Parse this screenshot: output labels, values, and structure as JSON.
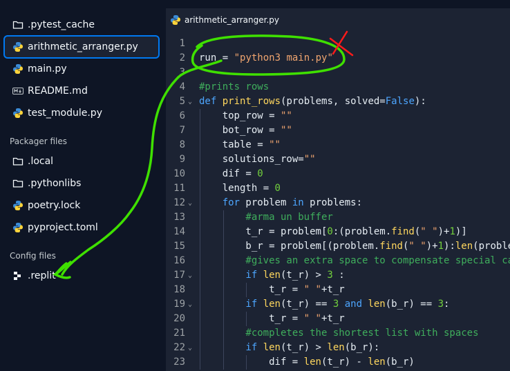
{
  "sidebar": {
    "files": [
      {
        "name": "pytest-cache-folder",
        "label": ".pytest_cache",
        "icon": "folder-icon"
      },
      {
        "name": "file-arithmetic-arranger",
        "label": "arithmetic_arranger.py",
        "icon": "python-icon"
      },
      {
        "name": "file-main",
        "label": "main.py",
        "icon": "python-icon"
      },
      {
        "name": "file-readme",
        "label": "README.md",
        "icon": "markdown-icon"
      },
      {
        "name": "file-test-module",
        "label": "test_module.py",
        "icon": "python-icon"
      }
    ],
    "packager_header": "Packager files",
    "packager_files": [
      {
        "label": ".local",
        "icon": "folder-icon"
      },
      {
        "label": ".pythonlibs",
        "icon": "folder-icon"
      },
      {
        "label": "poetry.lock",
        "icon": "python-icon"
      },
      {
        "label": "pyproject.toml",
        "icon": "python-icon"
      }
    ],
    "config_header": "Config files",
    "config_files": [
      {
        "label": ".replit",
        "icon": "replit-icon"
      }
    ]
  },
  "editor": {
    "tab_label": "arithmetic_arranger.py",
    "lines": [
      {
        "n": "1",
        "fold": false,
        "indent": 0,
        "tokens": []
      },
      {
        "n": "2",
        "fold": false,
        "indent": 0,
        "tokens": [
          [
            "var",
            "run"
          ],
          [
            "var",
            " = "
          ],
          [
            "str",
            "\"python3 main.py\""
          ]
        ]
      },
      {
        "n": "3",
        "fold": false,
        "indent": 0,
        "tokens": []
      },
      {
        "n": "4",
        "fold": false,
        "indent": 0,
        "tokens": [
          [
            "cmt",
            "#prints rows"
          ]
        ]
      },
      {
        "n": "5",
        "fold": true,
        "indent": 0,
        "tokens": [
          [
            "kw",
            "def "
          ],
          [
            "fn",
            "print_rows"
          ],
          [
            "var",
            "(problems, solved="
          ],
          [
            "bool",
            "False"
          ],
          [
            "var",
            "):"
          ]
        ]
      },
      {
        "n": "6",
        "fold": false,
        "indent": 1,
        "tokens": [
          [
            "var",
            "top_row = "
          ],
          [
            "str",
            "\"\""
          ]
        ]
      },
      {
        "n": "7",
        "fold": false,
        "indent": 1,
        "tokens": [
          [
            "var",
            "bot_row = "
          ],
          [
            "str",
            "\"\""
          ]
        ]
      },
      {
        "n": "8",
        "fold": false,
        "indent": 1,
        "tokens": [
          [
            "var",
            "table = "
          ],
          [
            "str",
            "\"\""
          ]
        ]
      },
      {
        "n": "9",
        "fold": false,
        "indent": 1,
        "tokens": [
          [
            "var",
            "solutions_row="
          ],
          [
            "str",
            "\"\""
          ]
        ]
      },
      {
        "n": "10",
        "fold": false,
        "indent": 1,
        "tokens": [
          [
            "var",
            "dif = "
          ],
          [
            "num",
            "0"
          ]
        ]
      },
      {
        "n": "11",
        "fold": false,
        "indent": 1,
        "tokens": [
          [
            "var",
            "length = "
          ],
          [
            "num",
            "0"
          ]
        ]
      },
      {
        "n": "12",
        "fold": true,
        "indent": 1,
        "tokens": [
          [
            "kw",
            "for "
          ],
          [
            "var",
            "problem "
          ],
          [
            "kw",
            "in "
          ],
          [
            "var",
            "problems:"
          ]
        ]
      },
      {
        "n": "13",
        "fold": false,
        "indent": 2,
        "tokens": [
          [
            "cmt",
            "#arma un buffer"
          ]
        ]
      },
      {
        "n": "14",
        "fold": false,
        "indent": 2,
        "tokens": [
          [
            "var",
            "t_r = problem["
          ],
          [
            "num",
            "0"
          ],
          [
            "var",
            ":(problem."
          ],
          [
            "fn",
            "find"
          ],
          [
            "var",
            "("
          ],
          [
            "str",
            "\" \""
          ],
          [
            "var",
            ")+"
          ],
          [
            "num",
            "1"
          ],
          [
            "var",
            ")]"
          ]
        ]
      },
      {
        "n": "15",
        "fold": false,
        "indent": 2,
        "tokens": [
          [
            "var",
            "b_r = problem[(problem."
          ],
          [
            "fn",
            "find"
          ],
          [
            "var",
            "("
          ],
          [
            "str",
            "\" \""
          ],
          [
            "var",
            ")+"
          ],
          [
            "num",
            "1"
          ],
          [
            "var",
            "):"
          ],
          [
            "fn",
            "len"
          ],
          [
            "var",
            "(problem)]"
          ]
        ]
      },
      {
        "n": "16",
        "fold": false,
        "indent": 2,
        "tokens": [
          [
            "cmt",
            "#gives an extra space to compensate special cases"
          ]
        ]
      },
      {
        "n": "17",
        "fold": true,
        "indent": 2,
        "tokens": [
          [
            "kw",
            "if "
          ],
          [
            "fn",
            "len"
          ],
          [
            "var",
            "(t_r) > "
          ],
          [
            "num",
            "3"
          ],
          [
            "var",
            " :"
          ]
        ]
      },
      {
        "n": "18",
        "fold": false,
        "indent": 3,
        "tokens": [
          [
            "var",
            "t_r = "
          ],
          [
            "str",
            "\" \""
          ],
          [
            "var",
            "+t_r"
          ]
        ]
      },
      {
        "n": "19",
        "fold": true,
        "indent": 2,
        "tokens": [
          [
            "kw",
            "if "
          ],
          [
            "fn",
            "len"
          ],
          [
            "var",
            "(t_r) == "
          ],
          [
            "num",
            "3"
          ],
          [
            "kw",
            " and "
          ],
          [
            "fn",
            "len"
          ],
          [
            "var",
            "(b_r) == "
          ],
          [
            "num",
            "3"
          ],
          [
            "var",
            ":"
          ]
        ]
      },
      {
        "n": "20",
        "fold": false,
        "indent": 3,
        "tokens": [
          [
            "var",
            "t_r = "
          ],
          [
            "str",
            "\" \""
          ],
          [
            "var",
            "+t_r"
          ]
        ]
      },
      {
        "n": "21",
        "fold": false,
        "indent": 2,
        "tokens": [
          [
            "cmt",
            "#completes the shortest list with spaces"
          ]
        ]
      },
      {
        "n": "22",
        "fold": true,
        "indent": 2,
        "tokens": [
          [
            "kw",
            "if "
          ],
          [
            "fn",
            "len"
          ],
          [
            "var",
            "(t_r) > "
          ],
          [
            "fn",
            "len"
          ],
          [
            "var",
            "(b_r):"
          ]
        ]
      },
      {
        "n": "23",
        "fold": false,
        "indent": 3,
        "tokens": [
          [
            "var",
            "dif = "
          ],
          [
            "fn",
            "len"
          ],
          [
            "var",
            "(t_r) - "
          ],
          [
            "fn",
            "len"
          ],
          [
            "var",
            "(b_r)"
          ]
        ]
      }
    ]
  },
  "colors": {
    "accent": "#0079f2",
    "annotation_green": "#3fe000",
    "annotation_red": "#ff1a1a"
  }
}
